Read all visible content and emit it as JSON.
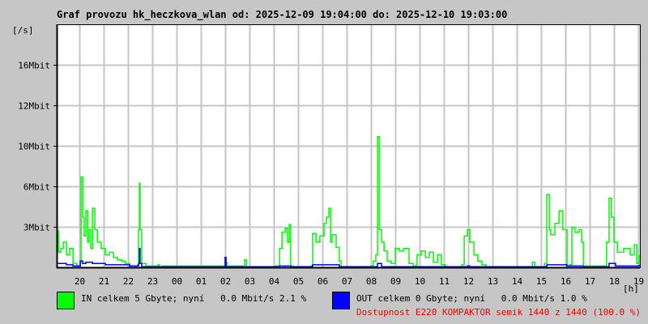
{
  "chart_data": {
    "type": "line",
    "title": "Graf provozu hk_heczkova_wlan od: 2025-12-09 19:04:00 do: 2025-12-10 19:03:00",
    "ylabel": "[/s]",
    "xlabel": "[h]",
    "x_unit": "hours since 2025-12-09 19:04",
    "y_unit": "Mbit/s",
    "xlim": [
      0,
      24
    ],
    "ylim": [
      0,
      19.35
    ],
    "grid": true,
    "y_ticks": [
      {
        "label": "3Mbit",
        "grid_index": 1
      },
      {
        "label": "6Mbit",
        "grid_index": 2
      },
      {
        "label": "10Mbit",
        "grid_index": 3
      },
      {
        "label": "12Mbit",
        "grid_index": 4
      },
      {
        "label": "16Mbit",
        "grid_index": 5
      }
    ],
    "x_ticks": [
      {
        "label": "20",
        "h": 0.93
      },
      {
        "label": "21",
        "h": 1.93
      },
      {
        "label": "22",
        "h": 2.93
      },
      {
        "label": "23",
        "h": 3.93
      },
      {
        "label": "00",
        "h": 4.93
      },
      {
        "label": "01",
        "h": 5.93
      },
      {
        "label": "02",
        "h": 6.93
      },
      {
        "label": "03",
        "h": 7.93
      },
      {
        "label": "04",
        "h": 8.93
      },
      {
        "label": "05",
        "h": 9.93
      },
      {
        "label": "06",
        "h": 10.93
      },
      {
        "label": "07",
        "h": 11.93
      },
      {
        "label": "08",
        "h": 12.93
      },
      {
        "label": "09",
        "h": 13.93
      },
      {
        "label": "10",
        "h": 14.93
      },
      {
        "label": "11",
        "h": 15.93
      },
      {
        "label": "12",
        "h": 16.93
      },
      {
        "label": "13",
        "h": 17.93
      },
      {
        "label": "14",
        "h": 18.93
      },
      {
        "label": "15",
        "h": 19.93
      },
      {
        "label": "16",
        "h": 20.93
      },
      {
        "label": "17",
        "h": 21.93
      },
      {
        "label": "18",
        "h": 22.93
      },
      {
        "label": "19",
        "h": 23.93
      }
    ],
    "series": [
      {
        "name": "IN",
        "color": "#00ff00",
        "points": [
          [
            0,
            2.9
          ],
          [
            0.07,
            1.2
          ],
          [
            0.17,
            1.5
          ],
          [
            0.27,
            2.0
          ],
          [
            0.4,
            1.0
          ],
          [
            0.53,
            1.5
          ],
          [
            0.67,
            0.3
          ],
          [
            0.83,
            0.1
          ],
          [
            0.97,
            0.3
          ],
          [
            1.0,
            7.2
          ],
          [
            1.07,
            4.0
          ],
          [
            1.13,
            2.5
          ],
          [
            1.2,
            4.5
          ],
          [
            1.27,
            2.0
          ],
          [
            1.33,
            3.0
          ],
          [
            1.4,
            1.5
          ],
          [
            1.47,
            4.7
          ],
          [
            1.57,
            3.0
          ],
          [
            1.67,
            2.0
          ],
          [
            1.83,
            1.5
          ],
          [
            2.0,
            1.0
          ],
          [
            2.17,
            1.2
          ],
          [
            2.33,
            0.8
          ],
          [
            2.5,
            0.6
          ],
          [
            2.67,
            0.5
          ],
          [
            2.83,
            0.3
          ],
          [
            3.0,
            0.1
          ],
          [
            3.33,
            0.2
          ],
          [
            3.37,
            3.0
          ],
          [
            3.4,
            6.7
          ],
          [
            3.43,
            3.0
          ],
          [
            3.5,
            0.3
          ],
          [
            3.67,
            0.1
          ],
          [
            4.17,
            0.2
          ],
          [
            4.23,
            0.05
          ],
          [
            4.33,
            0.1
          ],
          [
            6.87,
            0.1
          ],
          [
            6.93,
            0.4
          ],
          [
            7.0,
            0.1
          ],
          [
            7.67,
            0.1
          ],
          [
            7.73,
            0.6
          ],
          [
            7.8,
            0.05
          ],
          [
            9.0,
            0.1
          ],
          [
            9.17,
            1.5
          ],
          [
            9.27,
            2.8
          ],
          [
            9.4,
            3.1
          ],
          [
            9.5,
            2.0
          ],
          [
            9.57,
            3.4
          ],
          [
            9.63,
            0.1
          ],
          [
            9.73,
            0.05
          ],
          [
            10.47,
            0.1
          ],
          [
            10.53,
            2.7
          ],
          [
            10.67,
            2.0
          ],
          [
            10.83,
            2.5
          ],
          [
            11.0,
            3.5
          ],
          [
            11.1,
            4.0
          ],
          [
            11.2,
            4.7
          ],
          [
            11.27,
            2.0
          ],
          [
            11.33,
            2.6
          ],
          [
            11.5,
            1.6
          ],
          [
            11.63,
            0.5
          ],
          [
            11.7,
            0.05
          ],
          [
            12.93,
            0.1
          ],
          [
            13.03,
            0.5
          ],
          [
            13.13,
            1.0
          ],
          [
            13.2,
            10.4
          ],
          [
            13.27,
            3.0
          ],
          [
            13.37,
            2.0
          ],
          [
            13.47,
            1.3
          ],
          [
            13.6,
            0.5
          ],
          [
            13.77,
            0.3
          ],
          [
            13.93,
            1.5
          ],
          [
            14.1,
            1.3
          ],
          [
            14.27,
            1.5
          ],
          [
            14.5,
            0.3
          ],
          [
            14.67,
            0.1
          ],
          [
            14.83,
            1.0
          ],
          [
            15.0,
            1.3
          ],
          [
            15.17,
            0.8
          ],
          [
            15.33,
            1.2
          ],
          [
            15.5,
            0.4
          ],
          [
            15.67,
            1.0
          ],
          [
            15.83,
            0.2
          ],
          [
            16.0,
            0.05
          ],
          [
            16.67,
            0.2
          ],
          [
            16.77,
            2.5
          ],
          [
            16.9,
            3.0
          ],
          [
            17.0,
            2.0
          ],
          [
            17.17,
            1.0
          ],
          [
            17.33,
            0.5
          ],
          [
            17.5,
            0.2
          ],
          [
            17.67,
            0.05
          ],
          [
            19.5,
            0.05
          ],
          [
            19.57,
            0.4
          ],
          [
            19.67,
            0.05
          ],
          [
            20.07,
            0.3
          ],
          [
            20.17,
            5.8
          ],
          [
            20.27,
            3.0
          ],
          [
            20.33,
            2.6
          ],
          [
            20.5,
            3.5
          ],
          [
            20.67,
            4.5
          ],
          [
            20.83,
            3.0
          ],
          [
            21.0,
            0.1
          ],
          [
            21.1,
            0.2
          ],
          [
            21.2,
            3.2
          ],
          [
            21.33,
            2.8
          ],
          [
            21.5,
            3.0
          ],
          [
            21.6,
            2.0
          ],
          [
            21.67,
            0.1
          ],
          [
            22.5,
            0.1
          ],
          [
            22.63,
            2.0
          ],
          [
            22.73,
            5.5
          ],
          [
            22.83,
            4.0
          ],
          [
            22.93,
            2.0
          ],
          [
            23.07,
            1.2
          ],
          [
            23.33,
            1.5
          ],
          [
            23.6,
            1.0
          ],
          [
            23.77,
            1.8
          ],
          [
            23.87,
            0.3
          ],
          [
            23.97,
            1.0
          ]
        ]
      },
      {
        "name": "OUT",
        "color": "#0000ff",
        "points": [
          [
            0,
            0.3
          ],
          [
            0.4,
            0.2
          ],
          [
            0.67,
            0.1
          ],
          [
            0.97,
            0.5
          ],
          [
            1.07,
            0.3
          ],
          [
            1.2,
            0.4
          ],
          [
            1.47,
            0.3
          ],
          [
            2.0,
            0.2
          ],
          [
            2.67,
            0.2
          ],
          [
            3.0,
            0.1
          ],
          [
            3.37,
            0.3
          ],
          [
            3.4,
            1.5
          ],
          [
            3.43,
            0.3
          ],
          [
            3.5,
            0.05
          ],
          [
            6.93,
            0.8
          ],
          [
            6.97,
            0.05
          ],
          [
            9.17,
            0.1
          ],
          [
            9.63,
            0.05
          ],
          [
            10.53,
            0.2
          ],
          [
            11.2,
            0.2
          ],
          [
            11.63,
            0.05
          ],
          [
            13.2,
            0.3
          ],
          [
            13.37,
            0.05
          ],
          [
            16.9,
            0.1
          ],
          [
            17.0,
            0.05
          ],
          [
            20.17,
            0.2
          ],
          [
            21.0,
            0.1
          ],
          [
            21.67,
            0.05
          ],
          [
            22.73,
            0.3
          ],
          [
            23.0,
            0.1
          ],
          [
            23.97,
            0.2
          ]
        ]
      }
    ]
  },
  "legend": {
    "in": {
      "text": "IN celkem 5 Gbyte; nyní   0.0 Mbit/s 2.1 %",
      "color": "#00ff00"
    },
    "out": {
      "text": "OUT celkem 0 Gbyte; nyní   0.0 Mbit/s 1.0 %",
      "color": "#0000ff"
    },
    "availability": "Dostupnost E220 KOMPAKTOR semik 1440 z 1440 (100.0 %)"
  }
}
